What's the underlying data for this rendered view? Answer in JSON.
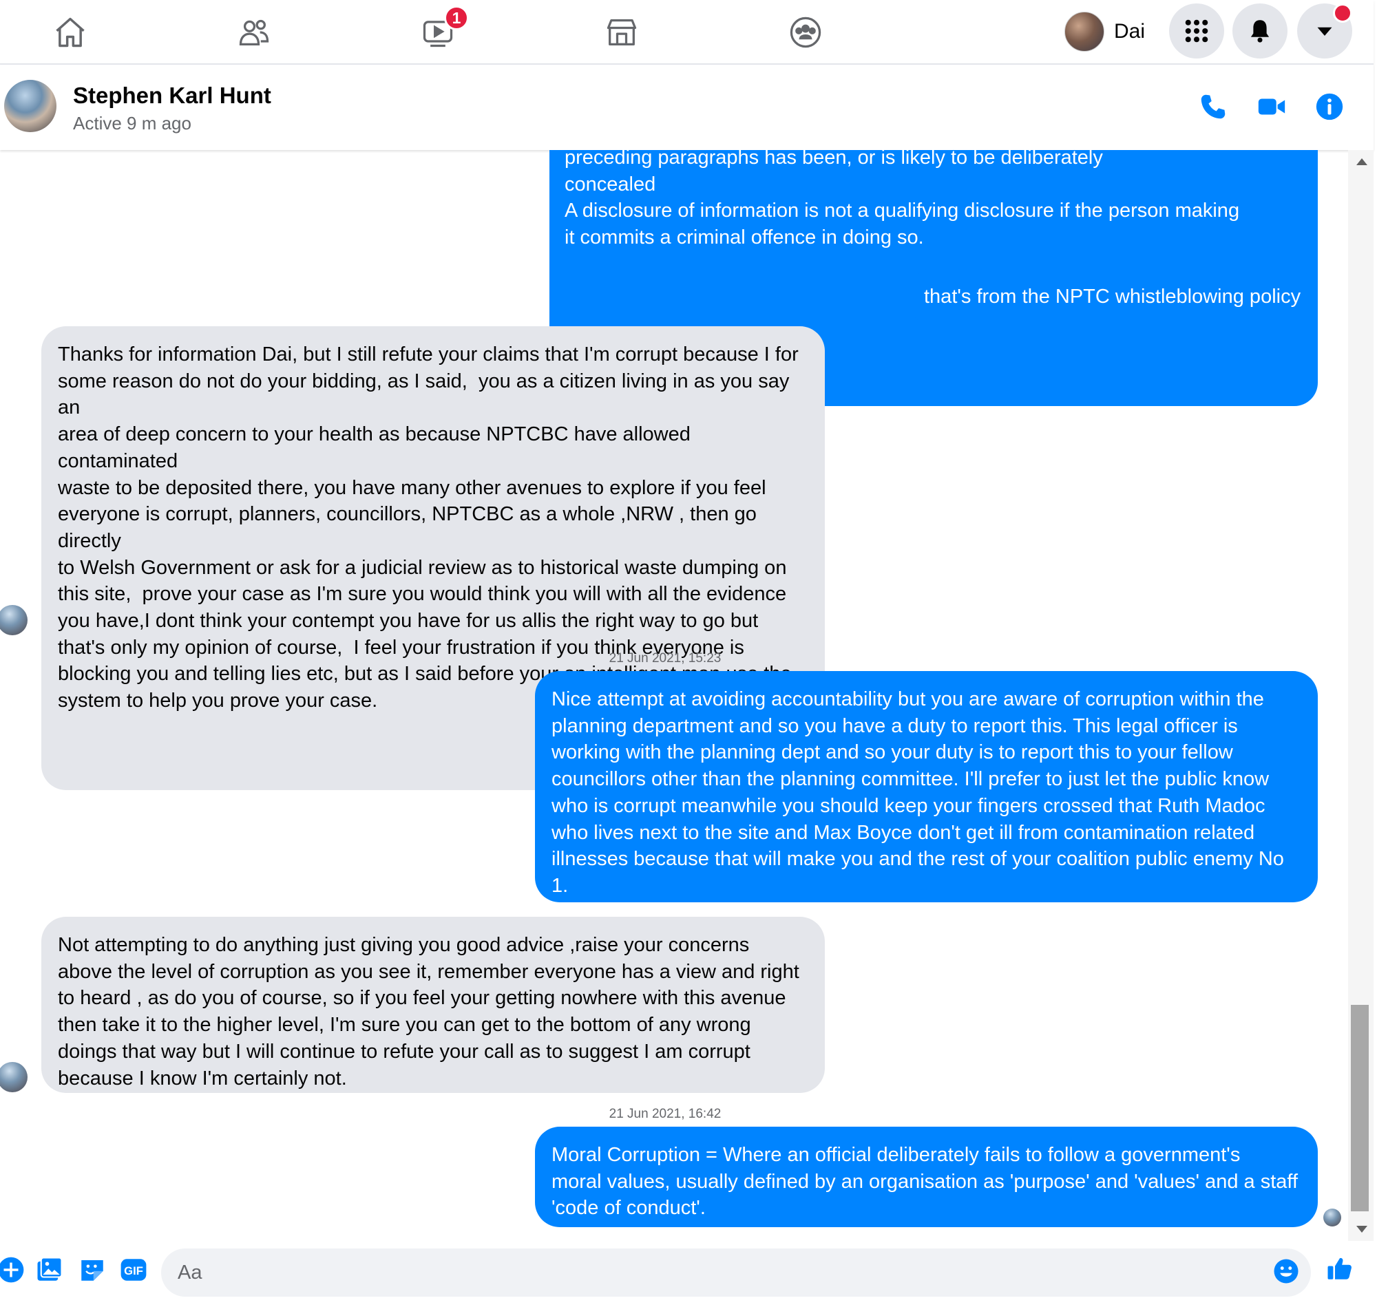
{
  "topnav": {
    "watch_badge": "1",
    "profile_name": "Dai"
  },
  "chat": {
    "contact_name": "Stephen Karl Hunt",
    "status": "Active 9 m ago"
  },
  "messages": [
    {
      "from": "me",
      "text": "preceding paragraphs has been, or is likely to be deliberately\nconcealed\nA disclosure of information is not a qualifying disclosure if the person making\nit commits a criminal offence in doing so."
    },
    {
      "from": "me",
      "text": "that's from the NPTC whistleblowing policy"
    },
    {
      "from": "them",
      "text": "Thanks for information Dai, but I still refute your claims that I'm corrupt because I for\nsome reason do not do your bidding, as I said,  you as a citizen living in as you say an\narea of deep concern to your health as because NPTCBC have allowed contaminated\nwaste to be deposited there, you have many other avenues to explore if you feel\neveryone is corrupt, planners, councillors, NPTCBC as a whole ,NRW , then go directly\nto Welsh Government or ask for a judicial review as to historical waste dumping on\nthis site,  prove your case as I'm sure you would think you will with all the evidence\nyou have,I dont think your contempt you have for us allis the right way to go but\nthat's only my opinion of course,  I feel your frustration if you think everyone is\nblocking you and telling lies etc, but as I said before your an intelligent man,use the\nsystem to help you prove your case."
    },
    {
      "from": "me",
      "timestamp": "21 Jun 2021, 15:23",
      "text": "Nice attempt at avoiding accountability but you are aware of corruption within the\nplanning department and so you have a duty to report this. This legal officer is\nworking with the planning dept and so your duty is to report this to your fellow\ncouncillors other than the planning committee. I'll prefer to just let the public know\nwho is corrupt meanwhile you should keep your fingers crossed that Ruth Madoc\nwho lives next to the site and Max Boyce don't get ill from contamination related\nillnesses because that will make you and the rest of your coalition public enemy No\n1."
    },
    {
      "from": "them",
      "text": "Not attempting to do anything just giving you good advice ,raise your concerns\nabove the level of corruption as you see it, remember everyone has a view and right\nto heard , as do you of course, so if you feel your getting nowhere with this avenue\nthen take it to the higher level, I'm sure you can get to the bottom of any wrong\ndoings that way but I will continue to refute your call as to suggest I am corrupt\nbecause I know I'm certainly not."
    },
    {
      "from": "me",
      "timestamp": "21 Jun 2021, 16:42",
      "text": "Moral Corruption = Where an official deliberately fails to follow a government's\nmoral values, usually defined by an organisation as 'purpose' and 'values' and a staff\n'code of conduct'."
    }
  ],
  "composer": {
    "placeholder": "Aa",
    "gif_label": "GIF"
  },
  "colors": {
    "outgoing_bubble": "#0084ff",
    "incoming_bubble": "#e4e6eb",
    "accent": "#0084ff",
    "badge": "#e41e3f"
  },
  "icons": {
    "nav": [
      "home-icon",
      "friends-icon",
      "watch-icon",
      "marketplace-icon",
      "groups-icon"
    ],
    "right": [
      "menu-grid-icon",
      "bell-icon",
      "caret-down-icon"
    ],
    "header": [
      "phone-icon",
      "video-camera-icon",
      "info-icon"
    ],
    "composer": [
      "plus-icon",
      "image-icon",
      "sticker-icon",
      "gif-icon",
      "emoji-icon",
      "thumbs-up-icon"
    ]
  }
}
